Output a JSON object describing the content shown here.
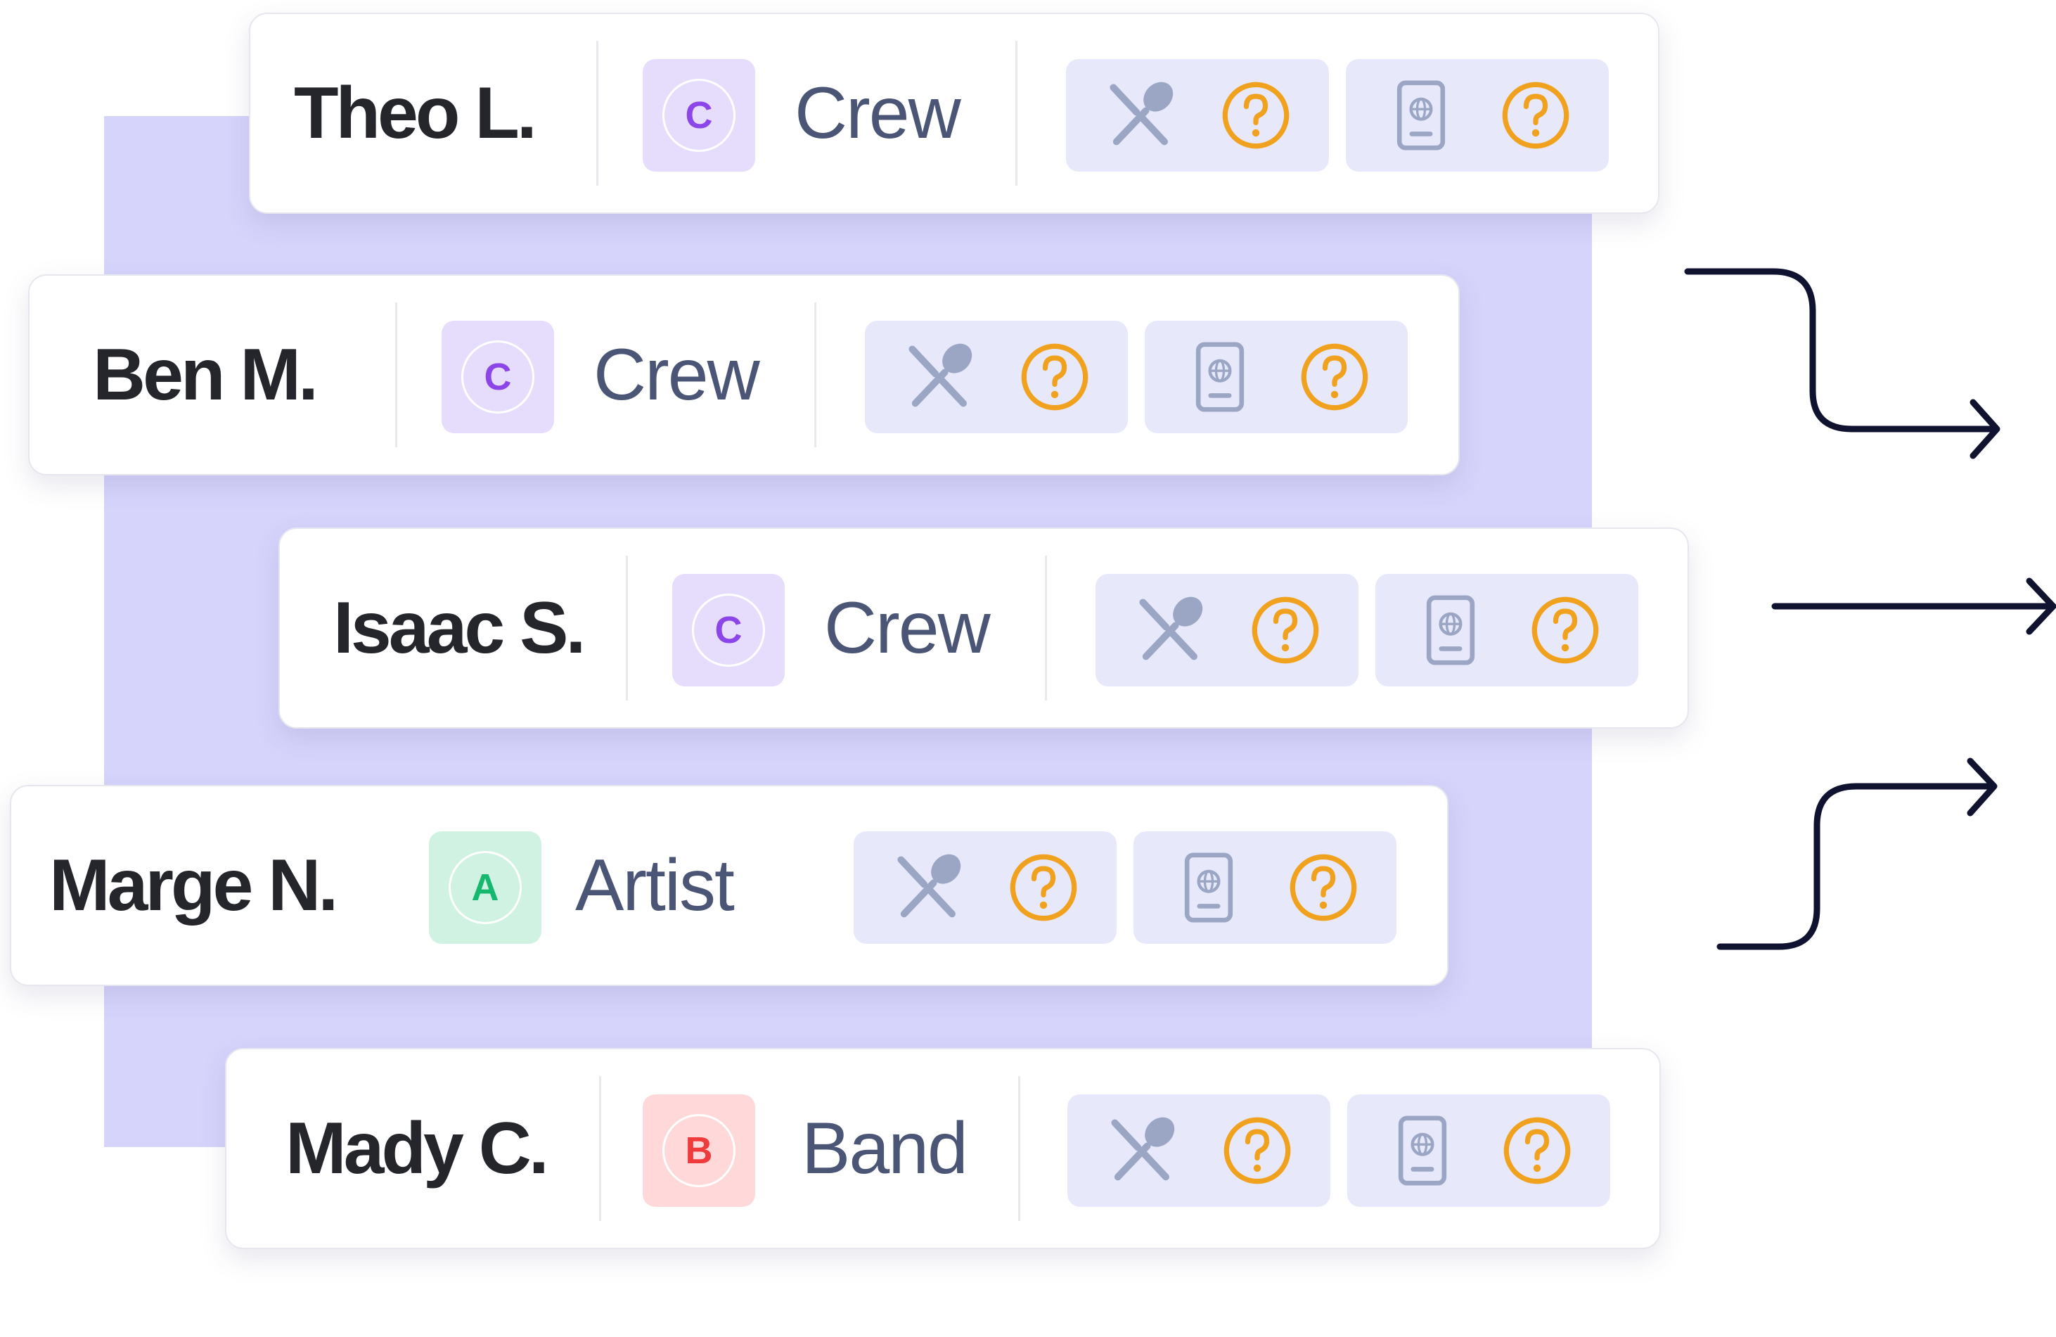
{
  "colors": {
    "backdrop": "#d6d4fb",
    "pill_bg": "#e7e8fa",
    "icon_gray": "#9aa6c4",
    "question_orange": "#f0a21e",
    "arrow_navy": "#0f1330"
  },
  "roles": {
    "crew": {
      "letter": "C",
      "badge_bg": "#e6dcfb",
      "letter_color": "#8b45e8"
    },
    "artist": {
      "letter": "A",
      "badge_bg": "#cff2e2",
      "letter_color": "#16b86f"
    },
    "band": {
      "letter": "B",
      "badge_bg": "#ffd9d9",
      "letter_color": "#ef3b3b"
    }
  },
  "people": [
    {
      "name": "Theo L.",
      "role_key": "crew",
      "role": "Crew",
      "meal_icon": "utensils-icon",
      "meal_status": "unknown",
      "passport_icon": "passport-icon",
      "passport_status": "unknown"
    },
    {
      "name": "Ben M.",
      "role_key": "crew",
      "role": "Crew",
      "meal_icon": "utensils-icon",
      "meal_status": "unknown",
      "passport_icon": "passport-icon",
      "passport_status": "unknown"
    },
    {
      "name": "Isaac S.",
      "role_key": "crew",
      "role": "Crew",
      "meal_icon": "utensils-icon",
      "meal_status": "unknown",
      "passport_icon": "passport-icon",
      "passport_status": "unknown"
    },
    {
      "name": "Marge N.",
      "role_key": "artist",
      "role": "Artist",
      "meal_icon": "utensils-icon",
      "meal_status": "unknown",
      "passport_icon": "passport-icon",
      "passport_status": "unknown"
    },
    {
      "name": "Mady C.",
      "role_key": "band",
      "role": "Band",
      "meal_icon": "utensils-icon",
      "meal_status": "unknown",
      "passport_icon": "passport-icon",
      "passport_status": "unknown"
    }
  ],
  "arrows": [
    {
      "icon": "arrow-down-right-icon"
    },
    {
      "icon": "arrow-right-icon"
    },
    {
      "icon": "arrow-up-right-icon"
    }
  ]
}
